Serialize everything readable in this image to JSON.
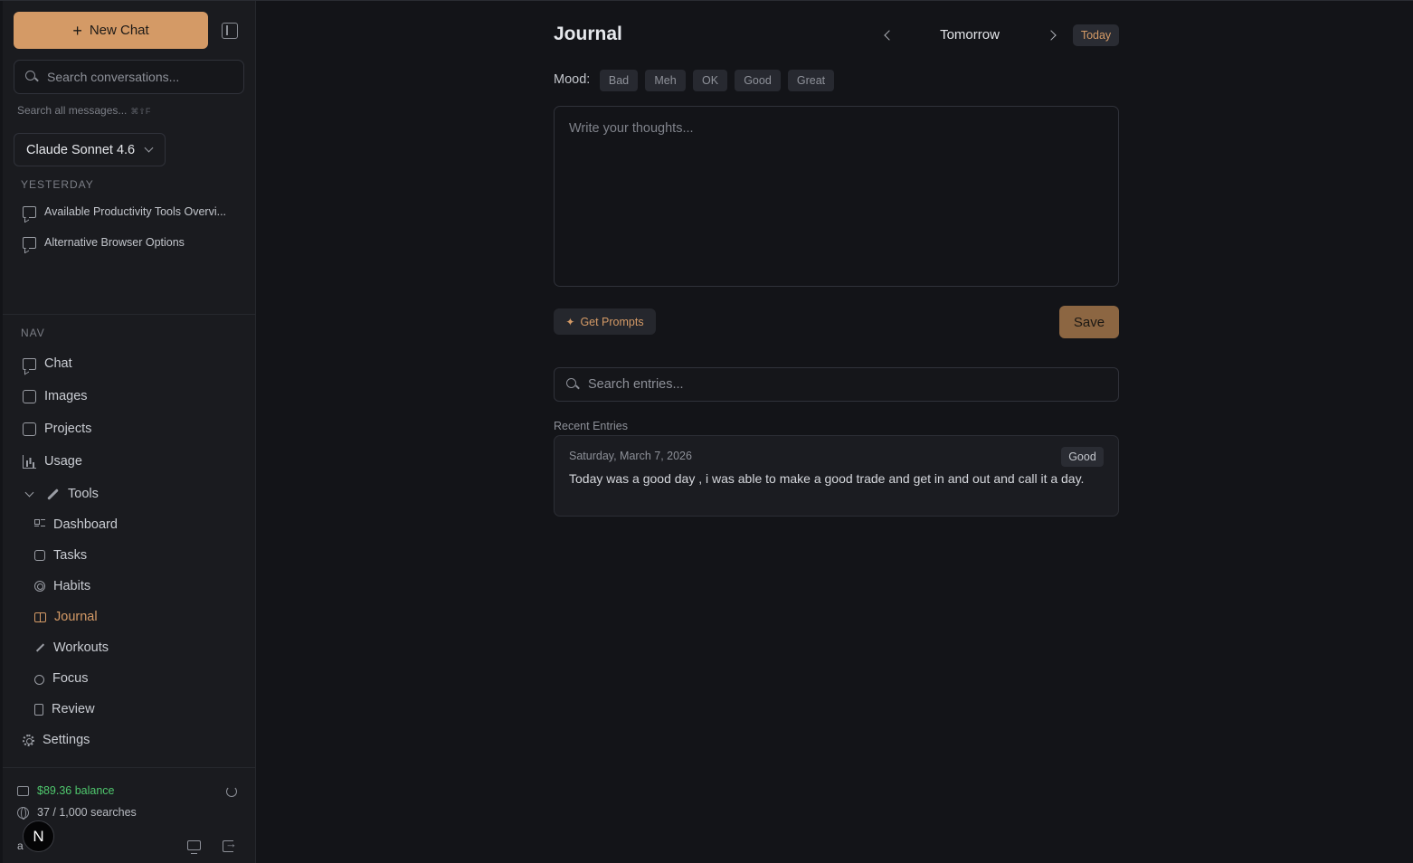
{
  "sidebar": {
    "new_chat_label": "New Chat",
    "search_placeholder": "Search conversations...",
    "search_all_label": "Search all messages...",
    "search_all_shortcut": "⌘⇧F",
    "model": "Claude Sonnet 4.6",
    "history_section": "YESTERDAY",
    "conversations": [
      {
        "title": "Available Productivity Tools Overvi..."
      },
      {
        "title": "Alternative Browser Options"
      }
    ],
    "nav_section": "NAV",
    "nav": {
      "chat": "Chat",
      "images": "Images",
      "projects": "Projects",
      "usage": "Usage",
      "tools": "Tools",
      "dashboard": "Dashboard",
      "tasks": "Tasks",
      "habits": "Habits",
      "journal": "Journal",
      "workouts": "Workouts",
      "focus": "Focus",
      "review": "Review",
      "settings": "Settings"
    },
    "balance": "$89.36 balance",
    "searches": "37 / 1,000 searches",
    "avatar_letter": "N",
    "user_initial": "a"
  },
  "main": {
    "title": "Journal",
    "date_label": "Tomorrow",
    "today_label": "Today",
    "mood_label": "Mood:",
    "moods": [
      "Bad",
      "Meh",
      "OK",
      "Good",
      "Great"
    ],
    "editor_placeholder": "Write your thoughts...",
    "prompts_label": "Get Prompts",
    "save_label": "Save",
    "search_placeholder": "Search entries...",
    "recent_label": "Recent Entries",
    "entries": [
      {
        "date": "Saturday, March 7, 2026",
        "mood": "Good",
        "text": "Today was a good day , i was able to make a good trade and get in and out and call it a day."
      }
    ]
  },
  "colors": {
    "accent": "#d49a66",
    "background": "#131418",
    "sidebar": "#1a1b1f",
    "balance": "#4fc76d"
  }
}
